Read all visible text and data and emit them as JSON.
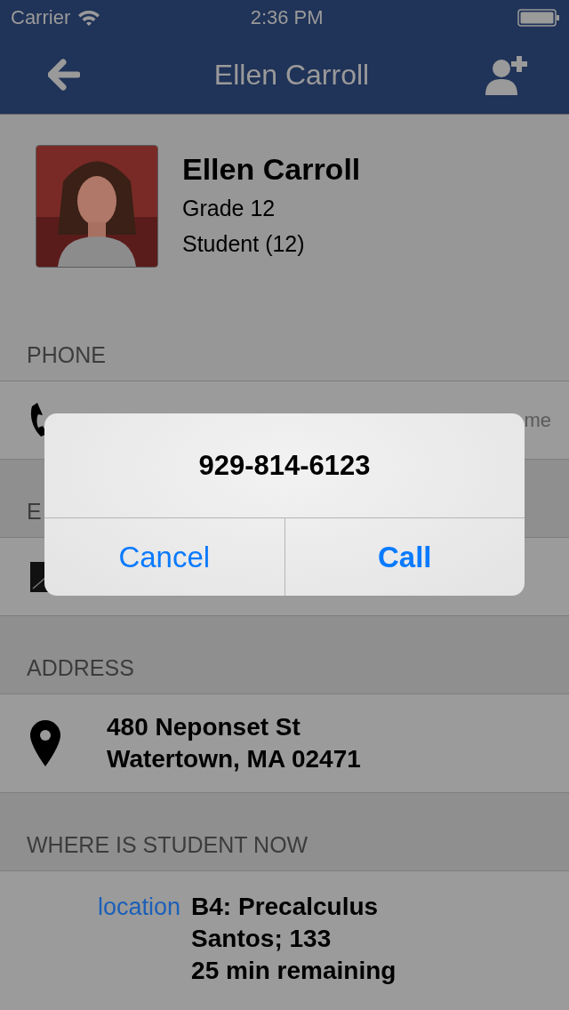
{
  "status_bar": {
    "carrier": "Carrier",
    "time": "2:36 PM"
  },
  "nav": {
    "title": "Ellen Carroll"
  },
  "profile": {
    "name": "Ellen Carroll",
    "grade": "Grade 12",
    "role": "Student (12)"
  },
  "sections": [
    {
      "header": "PHONE",
      "kind": "phone",
      "tag": "me"
    },
    {
      "header": "E",
      "kind": "email"
    },
    {
      "header": "ADDRESS",
      "kind": "address",
      "lines": [
        "480 Neponset St",
        "Watertown, MA 02471"
      ]
    },
    {
      "header": "WHERE IS STUDENT NOW",
      "kind": "location",
      "label": "location",
      "lines": [
        "B4: Precalculus",
        "Santos; 133",
        "25 min remaining"
      ]
    }
  ],
  "alert": {
    "message": "929-814-6123",
    "buttons": [
      {
        "label": "Cancel",
        "kind": "cancel"
      },
      {
        "label": "Call",
        "kind": "default"
      }
    ]
  }
}
